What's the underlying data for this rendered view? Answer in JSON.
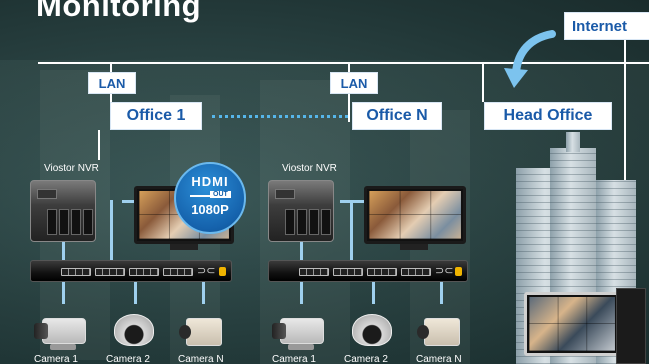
{
  "title": "Monitoring",
  "internet_label": "Internet",
  "head_office_label": "Head Office",
  "offices": [
    {
      "name": "Office 1",
      "lan_label": "LAN",
      "nvr_label": "Viostor NVR",
      "cameras": [
        "Camera 1",
        "Camera 2",
        "Camera N"
      ]
    },
    {
      "name": "Office N",
      "lan_label": "LAN",
      "nvr_label": "Viostor NVR",
      "cameras": [
        "Camera 1",
        "Camera 2",
        "Camera N"
      ]
    }
  ],
  "hdmi_badge": {
    "logo": "HDMI",
    "out_label": "OUT",
    "resolution": "1080P"
  },
  "colors": {
    "accent_blue": "#1a5aa8",
    "wire_blue": "#9fd0ee",
    "dots_blue": "#56b6ea",
    "badge_blue": "#1562ac"
  },
  "icons": [
    "dashed-connection-dots",
    "curved-arrow-icon",
    "hdmi-cable-icon"
  ]
}
